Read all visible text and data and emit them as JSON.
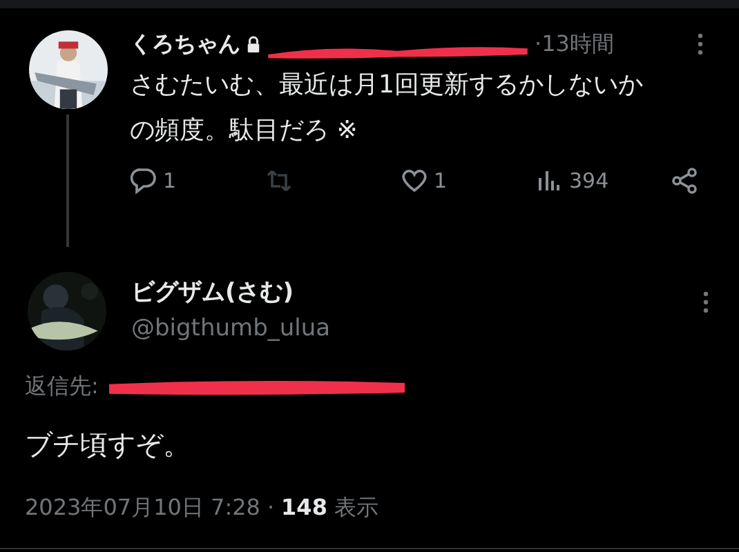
{
  "parent_tweet": {
    "display_name": "くろちゃん",
    "locked": true,
    "time": "·13時間",
    "text": "さむたいむ、最近は月1回更新するかしないかの頻度。駄目だろ ※",
    "actions": [
      {
        "kind": "reply",
        "count": "1"
      },
      {
        "kind": "retweet"
      },
      {
        "kind": "like",
        "count": "1"
      },
      {
        "kind": "views",
        "count": "394"
      },
      {
        "kind": "share"
      }
    ]
  },
  "tweet": {
    "display_name": "ビグザム(さむ)",
    "handle": "@bigthumb_ulua",
    "reply_label": "返信先:",
    "text": "ブチ頃すぞ。",
    "date": "2023年07月10日 7:28",
    "separator": "·",
    "views_count": "148",
    "views_label": "表示"
  }
}
